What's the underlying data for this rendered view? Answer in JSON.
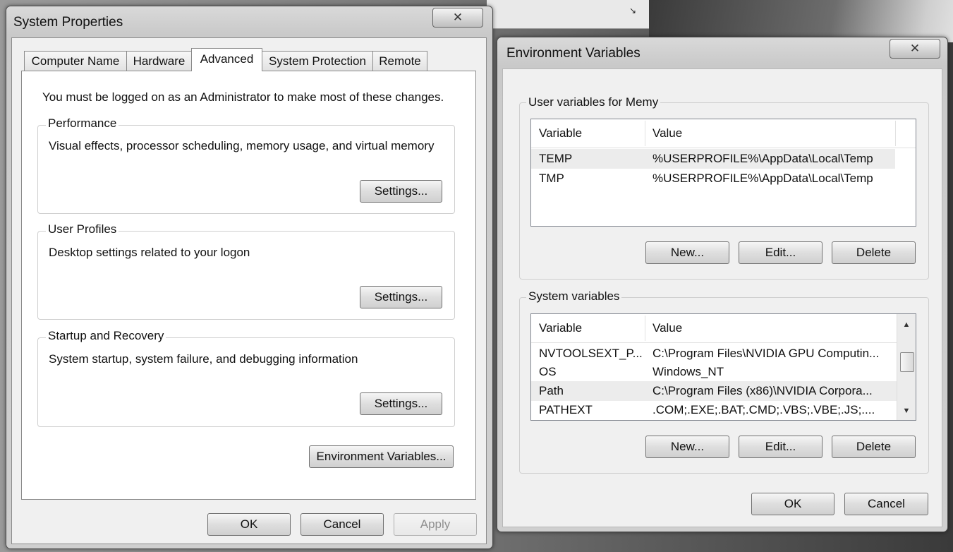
{
  "sysprops": {
    "title": "System Properties",
    "close_glyph": "✕",
    "tabs": [
      "Computer Name",
      "Hardware",
      "Advanced",
      "System Protection",
      "Remote"
    ],
    "active_tab": "Advanced",
    "admin_note": "You must be logged on as an Administrator to make most of these changes.",
    "performance": {
      "label": "Performance",
      "description": "Visual effects, processor scheduling, memory usage, and virtual memory",
      "settings_button": "Settings..."
    },
    "user_profiles": {
      "label": "User Profiles",
      "description": "Desktop settings related to your logon",
      "settings_button": "Settings..."
    },
    "startup_recovery": {
      "label": "Startup and Recovery",
      "description": "System startup, system failure, and debugging information",
      "settings_button": "Settings..."
    },
    "env_vars_button": "Environment Variables...",
    "ok": "OK",
    "cancel": "Cancel",
    "apply": "Apply"
  },
  "envvars": {
    "title": "Environment Variables",
    "close_glyph": "✕",
    "user_group_label": "User variables for Memy",
    "columns": [
      "Variable",
      "Value"
    ],
    "user_rows": [
      {
        "variable": "TEMP",
        "value": "%USERPROFILE%\\AppData\\Local\\Temp"
      },
      {
        "variable": "TMP",
        "value": "%USERPROFILE%\\AppData\\Local\\Temp"
      }
    ],
    "system_group_label": "System variables",
    "system_rows": [
      {
        "variable": "NVTOOLSEXT_P...",
        "value": "C:\\Program Files\\NVIDIA GPU Computin..."
      },
      {
        "variable": "OS",
        "value": "Windows_NT"
      },
      {
        "variable": "Path",
        "value": "C:\\Program Files (x86)\\NVIDIA Corpora..."
      },
      {
        "variable": "PATHEXT",
        "value": ".COM;.EXE;.BAT;.CMD;.VBS;.VBE;.JS;...."
      }
    ],
    "new": "New...",
    "edit": "Edit...",
    "delete": "Delete",
    "ok": "OK",
    "cancel": "Cancel",
    "scroll_up_glyph": "▲",
    "scroll_down_glyph": "▼"
  },
  "background": {
    "corner_glyph": "↘"
  }
}
